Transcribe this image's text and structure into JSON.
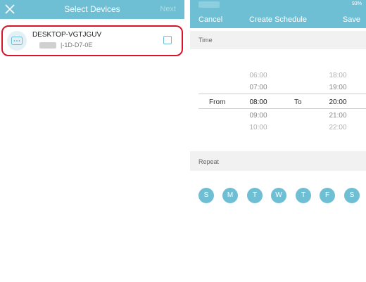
{
  "left": {
    "header": {
      "title": "Select Devices",
      "next_label": "Next"
    },
    "device": {
      "name": "DESKTOP-VGTJGUV",
      "mac": "|-1D-D7-0E",
      "checked": false
    }
  },
  "right": {
    "status": {
      "battery": "93%"
    },
    "header": {
      "cancel_label": "Cancel",
      "title": "Create Schedule",
      "save_label": "Save"
    },
    "time_section": {
      "label": "Time"
    },
    "picker": {
      "from_label": "From",
      "to_label": "To",
      "from_above": [
        "06:00",
        "07:00"
      ],
      "from_selected": "08:00",
      "from_below": [
        "09:00",
        "10:00"
      ],
      "to_above": [
        "18:00",
        "19:00"
      ],
      "to_selected": "20:00",
      "to_below": [
        "21:00",
        "22:00"
      ]
    },
    "repeat_section": {
      "label": "Repeat"
    },
    "days": [
      "S",
      "M",
      "T",
      "W",
      "T",
      "F",
      "S"
    ]
  },
  "colors": {
    "accent": "#6fbfd4",
    "highlight_border": "#d8142a"
  }
}
